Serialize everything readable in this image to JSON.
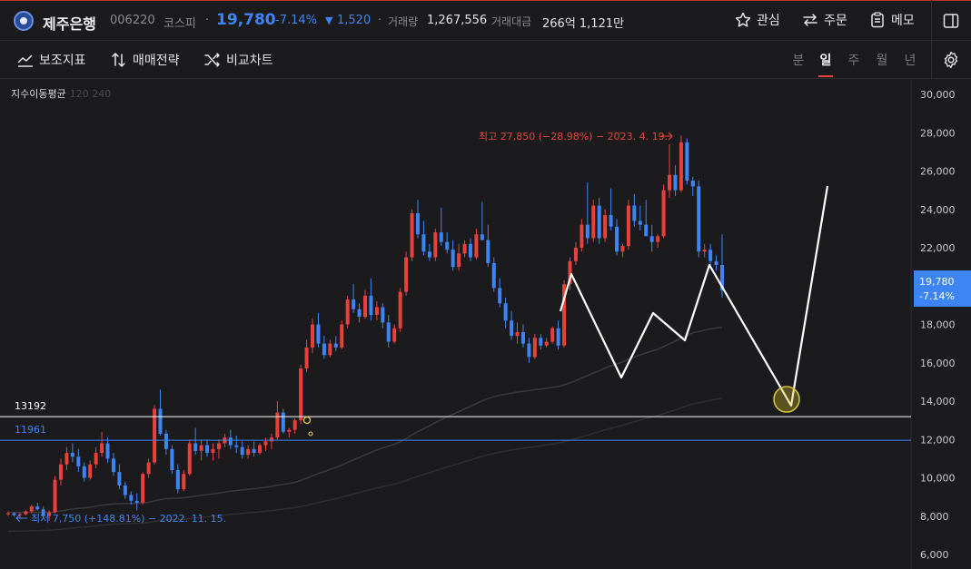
{
  "header": {
    "name": "제주은행",
    "code": "006220",
    "market": "코스피",
    "separator": "·",
    "price": "19,780",
    "change_pct": "-7.14%",
    "change_arrow": "▼",
    "change_amt": "1,520",
    "volume_label": "거래량",
    "volume": "1,267,556",
    "amount_label": "거래대금",
    "amount": "266억 1,121만",
    "buttons": {
      "watch": "관심",
      "order": "주문",
      "memo": "메모"
    }
  },
  "toolbar": {
    "indicators": "보조지표",
    "strategy": "매매전략",
    "compare": "비교차트",
    "periods": [
      "분",
      "일",
      "주",
      "월",
      "년"
    ],
    "active_period": "일"
  },
  "indicator_legend": {
    "label": "지수이동평균",
    "params": "120  240"
  },
  "colors": {
    "up": "#e8403b",
    "down": "#3d84f5",
    "accent": "#3d84f5"
  },
  "chart_data": {
    "type": "candlestick",
    "y_ticks": [
      "30,000",
      "28,000",
      "26,000",
      "24,000",
      "22,000",
      "20,000",
      "18,000",
      "16,000",
      "14,000",
      "12,000",
      "10,000",
      "8,000",
      "6,000"
    ],
    "ylim": [
      5500,
      31300
    ],
    "price_tag": {
      "price": "19,780",
      "pct": "-7.14%"
    },
    "high_annotation": "최고 27,850 (−28.98%) − 2023. 4. 19.",
    "low_annotation": "최저 7,750 (+148.81%) − 2022. 11. 15.",
    "lines": [
      {
        "label": "13192",
        "value": 13192,
        "color": "#ffffff"
      },
      {
        "label": "11961",
        "value": 11961,
        "color": "#3d84f5"
      }
    ],
    "candles": [
      [
        8100,
        8250,
        8000,
        8150
      ],
      [
        8150,
        8200,
        7980,
        8050
      ],
      [
        8050,
        8180,
        7900,
        8100
      ],
      [
        8100,
        8300,
        8050,
        8250
      ],
      [
        8250,
        8600,
        8150,
        8500
      ],
      [
        8500,
        8700,
        8300,
        8350
      ],
      [
        8350,
        8500,
        7900,
        8000
      ],
      [
        8000,
        8300,
        7750,
        8200
      ],
      [
        8200,
        10100,
        8150,
        9900
      ],
      [
        9900,
        11000,
        9600,
        10700
      ],
      [
        10700,
        11600,
        10400,
        11300
      ],
      [
        11300,
        11800,
        10800,
        11100
      ],
      [
        11100,
        11500,
        10300,
        10600
      ],
      [
        10600,
        10800,
        9800,
        10000
      ],
      [
        10000,
        10900,
        9900,
        10700
      ],
      [
        10700,
        11600,
        10500,
        11300
      ],
      [
        11300,
        12400,
        11100,
        11800
      ],
      [
        11800,
        12100,
        10800,
        11000
      ],
      [
        11000,
        11300,
        10100,
        10300
      ],
      [
        10300,
        10700,
        9400,
        9600
      ],
      [
        9600,
        9800,
        8900,
        9100
      ],
      [
        9100,
        9300,
        8600,
        8800
      ],
      [
        8800,
        9200,
        8300,
        8700
      ],
      [
        8700,
        10300,
        8600,
        10200
      ],
      [
        10200,
        11000,
        10000,
        10800
      ],
      [
        10800,
        13800,
        10700,
        13600
      ],
      [
        13600,
        14600,
        12200,
        12300
      ],
      [
        12300,
        12500,
        11200,
        11500
      ],
      [
        11500,
        11700,
        10200,
        10400
      ],
      [
        10400,
        10700,
        9200,
        9400
      ],
      [
        9400,
        10400,
        9300,
        10200
      ],
      [
        10200,
        12000,
        10100,
        11800
      ],
      [
        11800,
        12600,
        11200,
        11400
      ],
      [
        11400,
        12000,
        10900,
        11700
      ],
      [
        11700,
        12000,
        11100,
        11300
      ],
      [
        11300,
        11800,
        10900,
        11500
      ],
      [
        11500,
        12000,
        11000,
        11800
      ],
      [
        11800,
        12300,
        11600,
        12100
      ],
      [
        12100,
        12500,
        11500,
        11700
      ],
      [
        11700,
        12200,
        11300,
        11600
      ],
      [
        11600,
        11900,
        11000,
        11200
      ],
      [
        11200,
        11700,
        11000,
        11500
      ],
      [
        11500,
        11900,
        11100,
        11300
      ],
      [
        11300,
        11800,
        11200,
        11700
      ],
      [
        11700,
        12100,
        11400,
        11900
      ],
      [
        11900,
        12300,
        11500,
        12100
      ],
      [
        12100,
        14000,
        12000,
        13400
      ],
      [
        13400,
        13600,
        12300,
        12400
      ],
      [
        12400,
        12600,
        12100,
        12500
      ],
      [
        12500,
        13100,
        12300,
        13000
      ],
      [
        13000,
        15900,
        12800,
        15700
      ],
      [
        15700,
        17200,
        15500,
        16800
      ],
      [
        16800,
        18300,
        16500,
        18000
      ],
      [
        18000,
        18600,
        16800,
        17000
      ],
      [
        17000,
        17400,
        16200,
        16400
      ],
      [
        16400,
        17200,
        16300,
        17000
      ],
      [
        17000,
        17400,
        16600,
        16800
      ],
      [
        16800,
        18200,
        16700,
        18000
      ],
      [
        18000,
        19500,
        17800,
        19300
      ],
      [
        19300,
        20100,
        18600,
        18800
      ],
      [
        18800,
        19100,
        18100,
        18400
      ],
      [
        18400,
        19800,
        18300,
        19500
      ],
      [
        19500,
        20400,
        18200,
        18500
      ],
      [
        18500,
        19200,
        18200,
        18900
      ],
      [
        18900,
        19100,
        17800,
        18100
      ],
      [
        18100,
        18500,
        16800,
        17100
      ],
      [
        17100,
        18000,
        17000,
        17800
      ],
      [
        17800,
        19900,
        17600,
        19700
      ],
      [
        19700,
        21800,
        19500,
        21500
      ],
      [
        21500,
        24000,
        21300,
        23800
      ],
      [
        23800,
        24500,
        22500,
        22700
      ],
      [
        22700,
        23400,
        21600,
        21800
      ],
      [
        21800,
        22200,
        21300,
        21500
      ],
      [
        21500,
        23000,
        21300,
        22800
      ],
      [
        22800,
        24100,
        22100,
        22300
      ],
      [
        22300,
        22800,
        21700,
        21900
      ],
      [
        21900,
        22400,
        20800,
        21000
      ],
      [
        21000,
        22200,
        20800,
        21700
      ],
      [
        21700,
        22400,
        21500,
        22200
      ],
      [
        22200,
        22500,
        21300,
        21500
      ],
      [
        21500,
        23000,
        21400,
        22700
      ],
      [
        22700,
        24400,
        22500,
        22400
      ],
      [
        22400,
        23200,
        21000,
        21200
      ],
      [
        21200,
        21500,
        19700,
        19900
      ],
      [
        19900,
        20400,
        18900,
        19100
      ],
      [
        19100,
        19400,
        17800,
        18200
      ],
      [
        18200,
        18700,
        17200,
        17400
      ],
      [
        17400,
        18100,
        17000,
        17600
      ],
      [
        17600,
        18000,
        16800,
        17000
      ],
      [
        17000,
        17300,
        16000,
        16300
      ],
      [
        16300,
        17500,
        16200,
        17300
      ],
      [
        17300,
        17500,
        16700,
        16900
      ],
      [
        16900,
        17300,
        16800,
        17100
      ],
      [
        17100,
        17900,
        17000,
        17800
      ],
      [
        17800,
        18200,
        16700,
        16900
      ],
      [
        16900,
        20300,
        16800,
        20100
      ],
      [
        20100,
        21500,
        19800,
        21300
      ],
      [
        21300,
        22300,
        21100,
        22000
      ],
      [
        22000,
        23500,
        21800,
        23200
      ],
      [
        23200,
        25400,
        22200,
        22500
      ],
      [
        22500,
        24500,
        22300,
        24200
      ],
      [
        24200,
        24600,
        22200,
        22500
      ],
      [
        22500,
        24000,
        22300,
        23700
      ],
      [
        23700,
        25100,
        22900,
        23100
      ],
      [
        23100,
        23500,
        21600,
        21800
      ],
      [
        21800,
        22200,
        21500,
        22100
      ],
      [
        22100,
        24500,
        21900,
        24200
      ],
      [
        24200,
        24800,
        23100,
        23400
      ],
      [
        23400,
        24200,
        22900,
        23200
      ],
      [
        23200,
        24500,
        23000,
        22600
      ],
      [
        22600,
        23200,
        21800,
        22300
      ],
      [
        22300,
        22700,
        22000,
        22600
      ],
      [
        22600,
        25300,
        22500,
        25000
      ],
      [
        25000,
        27400,
        24600,
        25800
      ],
      [
        25800,
        26300,
        24700,
        25000
      ],
      [
        25000,
        27850,
        24900,
        27500
      ],
      [
        27500,
        27700,
        25300,
        25500
      ],
      [
        25500,
        25700,
        24700,
        25200
      ],
      [
        25200,
        25500,
        21500,
        21800
      ],
      [
        21800,
        22200,
        21500,
        21900
      ],
      [
        21900,
        22200,
        20900,
        21300
      ],
      [
        21300,
        21600,
        20800,
        21100
      ],
      [
        21100,
        22700,
        19400,
        19780
      ]
    ]
  }
}
